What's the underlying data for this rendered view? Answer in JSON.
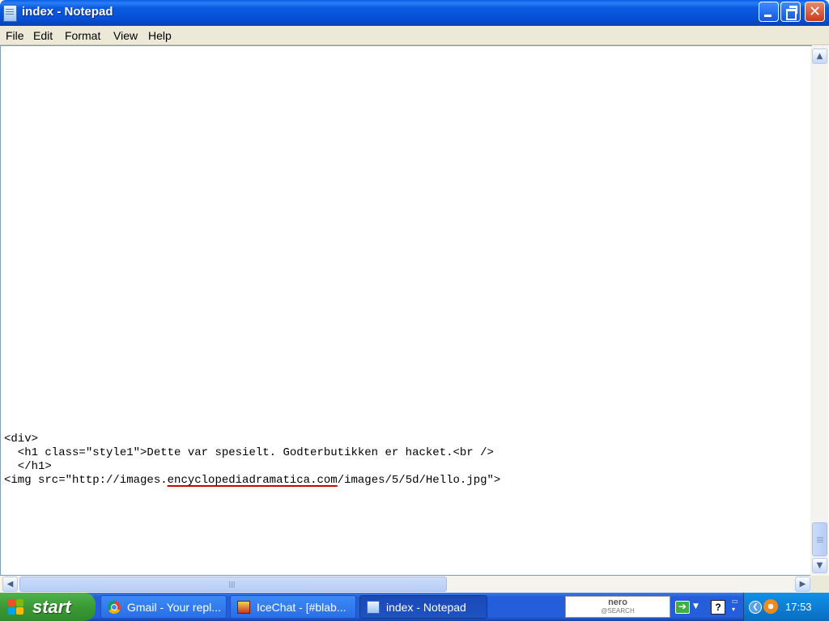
{
  "window": {
    "title": "index - Notepad",
    "close_glyph": "✕"
  },
  "menu": {
    "items": [
      "File",
      "Edit",
      "Format",
      "View",
      "Help"
    ]
  },
  "editor": {
    "lines": [
      "<div>",
      "  <h1 class=\"style1\">Dette var spesielt. Godterbutikken er hacket.<br />",
      "  </h1>"
    ],
    "img_line_prefix": "<img src=\"http://images.",
    "img_line_underlined": "encyclopediadramatica.com",
    "img_line_suffix": "/images/5/5d/Hello.jpg\">"
  },
  "taskbar": {
    "start_label": "start",
    "tasks": [
      {
        "label": "Gmail - Your repl...",
        "icon": "chrome-icon"
      },
      {
        "label": "IceChat - [#blab...",
        "icon": "icechat-icon"
      },
      {
        "label": "index - Notepad",
        "icon": "notepad-icon",
        "active": true
      }
    ],
    "nero_label": "nero",
    "nero_sub": "@SEARCH",
    "clock": "17:53"
  }
}
